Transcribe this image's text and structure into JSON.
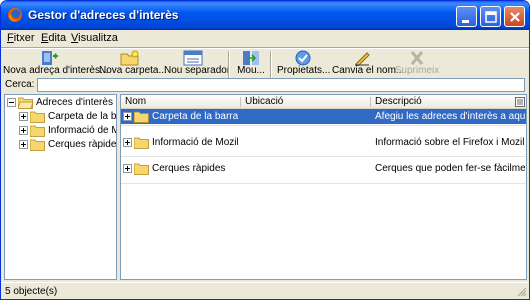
{
  "window": {
    "title": "Gestor d'adreces d'interès"
  },
  "menu": {
    "items": [
      "Fitxer",
      "Edita",
      "Visualitza"
    ]
  },
  "toolbar": {
    "buttons": [
      {
        "label": "Nova adreça d'interès...",
        "icon": "new-bookmark-icon",
        "disabled": false
      },
      {
        "label": "Nova carpeta...",
        "icon": "new-folder-icon",
        "disabled": false
      },
      {
        "label": "Nou separador",
        "icon": "new-separator-icon",
        "disabled": false
      },
      {
        "label": "Mou...",
        "icon": "move-icon",
        "disabled": false
      },
      {
        "label": "Propietats...",
        "icon": "properties-icon",
        "disabled": false
      },
      {
        "label": "Canvia el nom...",
        "icon": "rename-icon",
        "disabled": false
      },
      {
        "label": "Suprimeix",
        "icon": "delete-icon",
        "disabled": true
      }
    ]
  },
  "search": {
    "label": "Cerca:",
    "value": ""
  },
  "tree": {
    "root": "Adreces d'interès",
    "children": [
      "Carpeta de la barra d'...",
      "Informació de Mozilla i ...",
      "Cerques ràpides"
    ]
  },
  "list": {
    "columns": [
      "Nom",
      "Ubicació",
      "Descripció"
    ],
    "rows": [
      {
        "name": "Carpeta de la barra d'...",
        "location": "",
        "description": "Afegiu les adreces d'interès a aque...",
        "selected": true
      },
      {
        "name": "Informació de Mozilla i ...",
        "location": "",
        "description": "Informació sobre el Firefox i Mozilla.",
        "selected": false
      },
      {
        "name": "Cerques ràpides",
        "location": "",
        "description": "Cerques que poden fer-se fàcilmen...",
        "selected": false
      }
    ]
  },
  "status": {
    "text": "5 objecte(s)"
  },
  "colors": {
    "titlebar": "#0058ee",
    "selection": "#316ac5",
    "chrome": "#ece9d8",
    "folder": "#f5d76e"
  }
}
